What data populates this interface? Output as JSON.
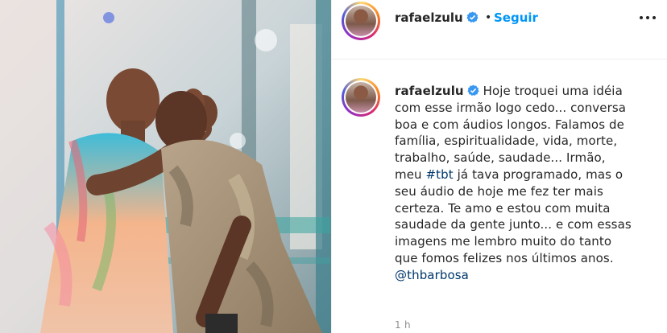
{
  "post": {
    "username": "rafaelzulu",
    "dot": "•",
    "follow_label": "Seguir",
    "verified_icon": "verified-badge-icon",
    "more_icon": "more-options-icon",
    "accent_color": "#0095f6",
    "caption": {
      "line1": "Hoje troquei uma idéia",
      "line2": "com esse irmão logo cedo... conversa",
      "line3": "boa e com áudios longos. Falamos de",
      "line4": "família, espiritualidade, vida, morte,",
      "line5": "trabalho, saúde, saudade... Irmão,",
      "line6_prefix": "meu ",
      "hashtag": "#tbt",
      "line6_suffix": " já tava programado, mas o",
      "line7": "seu áudio de hoje me fez ter mais",
      "line8": "certeza. Te amo e estou com muita",
      "line9": "saudade da gente junto... e com essas",
      "line10": "imagens me lembro muito do tanto",
      "line11": "que fomos felizes nos últimos anos.",
      "mention": "@thbarbosa"
    },
    "timestamp": "1 h"
  }
}
